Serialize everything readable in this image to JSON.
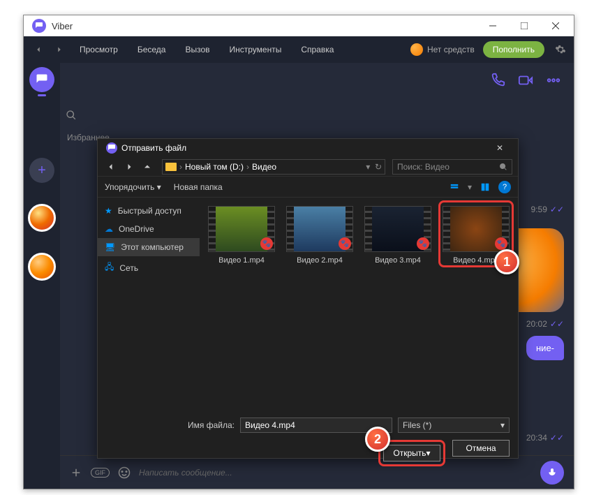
{
  "window": {
    "title": "Viber"
  },
  "toolbar": {
    "view": "Просмотр",
    "chat": "Беседа",
    "call": "Вызов",
    "tools": "Инструменты",
    "help": "Справка",
    "no_balance": "Нет средств",
    "topup": "Пополнить"
  },
  "sidebar": {
    "favorites_label": "Избраннее"
  },
  "chat": {
    "msg1_time": "9:59",
    "msg2_time": "20:02",
    "msg2_text": "ние-",
    "msg3_time": "20:34",
    "input_placeholder": "Написать сообщение..."
  },
  "dialog": {
    "title": "Отправить файл",
    "path_drive": "Новый том (D:)",
    "path_folder": "Видео",
    "search_placeholder": "Поиск: Видео",
    "organize": "Упорядочить",
    "new_folder": "Новая папка",
    "tree": {
      "quick": "Быстрый доступ",
      "onedrive": "OneDrive",
      "thispc": "Этот компьютер",
      "network": "Сеть"
    },
    "files": [
      {
        "name": "Видео 1.mp4"
      },
      {
        "name": "Видео 2.mp4"
      },
      {
        "name": "Видео 3.mp4"
      },
      {
        "name": "Видео 4.mp4"
      }
    ],
    "filename_label": "Имя файла:",
    "filename_value": "Видео 4.mp4",
    "filetype": "Files (*)",
    "open": "Открыть",
    "cancel": "Отмена"
  },
  "annotations": {
    "step1": "1",
    "step2": "2"
  }
}
